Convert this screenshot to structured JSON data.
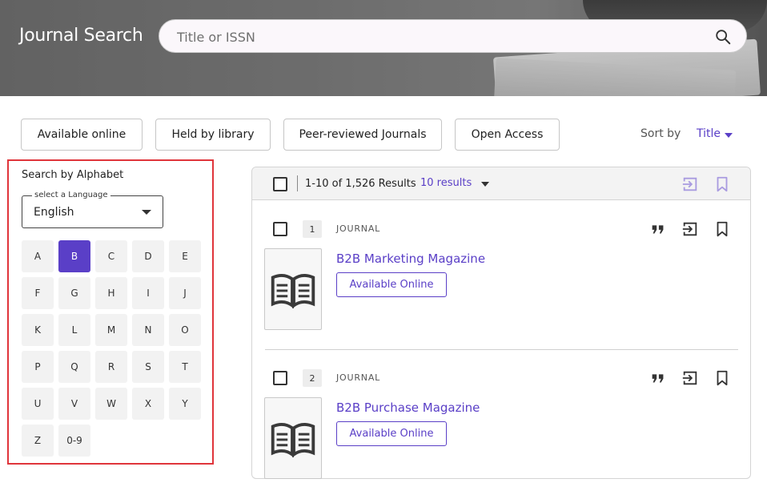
{
  "header": {
    "title": "Journal Search",
    "search_placeholder": "Title or ISSN"
  },
  "filters": [
    "Available online",
    "Held by library",
    "Peer-reviewed Journals",
    "Open Access"
  ],
  "sort": {
    "label": "Sort by",
    "value": "Title"
  },
  "alphabet": {
    "title": "Search by Alphabet",
    "language_label": "select a Language",
    "language_value": "English",
    "letters": [
      "A",
      "B",
      "C",
      "D",
      "E",
      "F",
      "G",
      "H",
      "I",
      "J",
      "K",
      "L",
      "M",
      "N",
      "O",
      "P",
      "Q",
      "R",
      "S",
      "T",
      "U",
      "V",
      "W",
      "X",
      "Y",
      "Z",
      "0-9"
    ],
    "active": "B"
  },
  "results": {
    "count_text": "1-10 of 1,526 Results",
    "per_page": "10 results",
    "items": [
      {
        "number": "1",
        "type": "JOURNAL",
        "title": "B2B Marketing Magazine",
        "availability": "Available Online"
      },
      {
        "number": "2",
        "type": "JOURNAL",
        "title": "B2B Purchase Magazine",
        "availability": "Available Online"
      }
    ]
  },
  "colors": {
    "accent": "#5a3fc7",
    "highlight_border": "#e0353b"
  }
}
